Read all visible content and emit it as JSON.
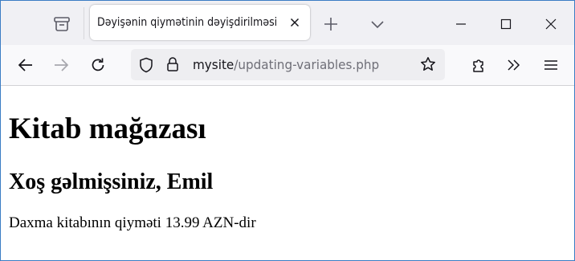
{
  "tab": {
    "title": "Dəyişənin qiymətinin dəyişdirilməsi"
  },
  "address_bar": {
    "host": "mysite",
    "path": "/updating-variables.php"
  },
  "page": {
    "heading": "Kitab mağazası",
    "subheading": "Xoş gəlmişsiniz, Emil",
    "paragraph": "Daxma kitabının qiyməti 13.99 AZN-dir"
  },
  "icons": {
    "tab_overview": "tab-overview-icon",
    "tab_close": "close-icon",
    "new_tab": "plus-icon",
    "list_all_tabs": "chevron-down-icon",
    "minimize": "minimize-icon",
    "maximize": "maximize-icon",
    "window_close": "close-icon",
    "back": "back-arrow-icon",
    "forward": "forward-arrow-icon",
    "reload": "reload-icon",
    "tracking_protection": "shield-icon",
    "connection": "lock-icon",
    "bookmark": "star-icon",
    "extensions": "puzzle-icon",
    "overflow": "double-chevron-icon",
    "menu": "hamburger-icon"
  },
  "colors": {
    "tabbar_bg": "#f0f0f4",
    "navbar_bg": "#f9f9fb",
    "urlbar_bg": "#eeeef1",
    "window_border": "#3b7dc4",
    "icon": "#5b5b66"
  }
}
